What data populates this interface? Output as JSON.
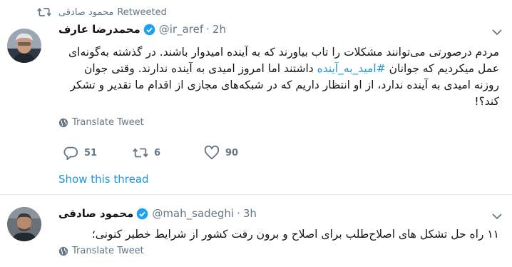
{
  "retweet_line": {
    "retweeter_name": "محمود صادقی",
    "label": "Retweeted"
  },
  "tweet1": {
    "display_name": "محمدرضا عارف",
    "handle": "@ir_aref",
    "time": "2h",
    "text_before_hashtag": "مردم درصورتی می‌توانند مشکلات را تاب بیاورند که به آینده امیدوار باشند. در گذشته به‌گونه‌ای عمل میکردیم که جوانان ",
    "hashtag": "#امید_به_آینده",
    "text_after_hashtag": " داشتند اما امروز امیدی به آینده ندارند. وقتی جوان روزنه امیدی به آینده ندارد، از او انتظار داریم که در شبکه‌های مجازی از اقدام ما تقدیر و تشکر کند؟!",
    "translate_label": "Translate Tweet",
    "reply_count": "51",
    "retweet_count": "6",
    "like_count": "90",
    "show_thread_label": "Show this thread"
  },
  "tweet2": {
    "display_name": "محمود صادقی",
    "handle": "@mah_sadeghi",
    "time": "3h",
    "text": "۱۱ راه حل تشکل های اصلاح‌طلب برای اصلاح و برون رفت کشور از شرایط خطیر کنونی؛",
    "translate_label": "Translate Tweet"
  },
  "colors": {
    "link": "#1b95e0",
    "muted": "#657786",
    "text": "#14171a",
    "divider": "#e1e8ed"
  },
  "icons": {
    "retweet": "retweet-icon",
    "verified": "verified-badge-icon",
    "caret": "chevron-down-icon",
    "globe": "globe-icon",
    "reply": "reply-icon",
    "like": "heart-icon"
  }
}
